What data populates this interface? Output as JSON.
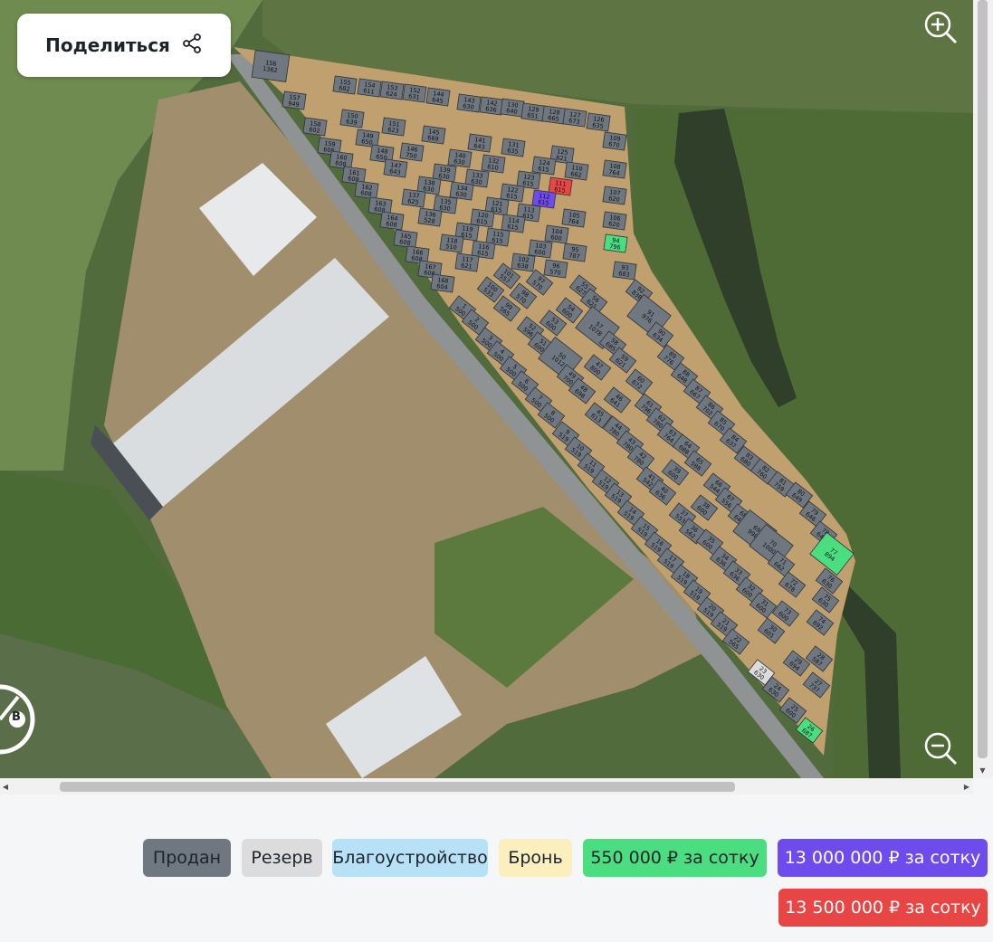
{
  "share": {
    "label": "Поделиться",
    "icon": "share-icon"
  },
  "compass": {
    "letter": "В"
  },
  "colors": {
    "sold": "#6f7780",
    "reserve": "#dcdcdc",
    "improvement": "#b6e1f7",
    "booked": "#fbefbd",
    "price_550k": "#4ade80",
    "price_13m": "#6d4bed",
    "price_13_5m": "#e84545",
    "road": "#bfa06e"
  },
  "legend": [
    {
      "label": "Продан",
      "color": "#6f7780"
    },
    {
      "label": "Резерв",
      "color": "#dcdcdc"
    },
    {
      "label": "Благоустройство",
      "color": "#b6e1f7"
    },
    {
      "label": "Бронь",
      "color": "#fbefbd"
    },
    {
      "label": "550 000 ₽ за сотку",
      "color": "#4ade80"
    },
    {
      "label": "13 000 000 ₽ за сотку",
      "color": "#6d4bed"
    },
    {
      "label": "13 500 000 ₽ за сотку",
      "color": "#e84545"
    }
  ],
  "plots": [
    {
      "n": "156",
      "a": "1362",
      "s": "sold"
    },
    {
      "n": "157",
      "a": "949",
      "s": "sold"
    },
    {
      "n": "158",
      "a": "602",
      "s": "sold"
    },
    {
      "n": "155",
      "a": "682",
      "s": "sold"
    },
    {
      "n": "154",
      "a": "611",
      "s": "sold"
    },
    {
      "n": "153",
      "a": "624",
      "s": "sold"
    },
    {
      "n": "152",
      "a": "631",
      "s": "sold"
    },
    {
      "n": "144",
      "a": "645",
      "s": "sold"
    },
    {
      "n": "143",
      "a": "630",
      "s": "sold"
    },
    {
      "n": "142",
      "a": "636",
      "s": "sold"
    },
    {
      "n": "130",
      "a": "640",
      "s": "sold"
    },
    {
      "n": "129",
      "a": "651",
      "s": "sold"
    },
    {
      "n": "128",
      "a": "665",
      "s": "sold"
    },
    {
      "n": "127",
      "a": "673",
      "s": "sold"
    },
    {
      "n": "126",
      "a": "635",
      "s": "sold"
    },
    {
      "n": "150",
      "a": "639",
      "s": "sold"
    },
    {
      "n": "151",
      "a": "623",
      "s": "sold"
    },
    {
      "n": "145",
      "a": "669",
      "s": "sold"
    },
    {
      "n": "159",
      "a": "606",
      "s": "sold"
    },
    {
      "n": "149",
      "a": "650",
      "s": "sold"
    },
    {
      "n": "148",
      "a": "650",
      "s": "sold"
    },
    {
      "n": "146",
      "a": "750",
      "s": "sold"
    },
    {
      "n": "141",
      "a": "643",
      "s": "sold"
    },
    {
      "n": "131",
      "a": "635",
      "s": "sold"
    },
    {
      "n": "160",
      "a": "608",
      "s": "sold"
    },
    {
      "n": "147",
      "a": "643",
      "s": "sold"
    },
    {
      "n": "140",
      "a": "630",
      "s": "sold"
    },
    {
      "n": "132",
      "a": "610",
      "s": "sold"
    },
    {
      "n": "125",
      "a": "621",
      "s": "sold"
    },
    {
      "n": "109",
      "a": "670",
      "s": "sold"
    },
    {
      "n": "161",
      "a": "608",
      "s": "sold"
    },
    {
      "n": "139",
      "a": "630",
      "s": "sold"
    },
    {
      "n": "133",
      "a": "630",
      "s": "sold"
    },
    {
      "n": "124",
      "a": "615",
      "s": "sold"
    },
    {
      "n": "110",
      "a": "662",
      "s": "sold"
    },
    {
      "n": "108",
      "a": "764",
      "s": "sold"
    },
    {
      "n": "162",
      "a": "608",
      "s": "sold"
    },
    {
      "n": "138",
      "a": "630",
      "s": "sold"
    },
    {
      "n": "134",
      "a": "630",
      "s": "sold"
    },
    {
      "n": "123",
      "a": "615",
      "s": "sold"
    },
    {
      "n": "111",
      "a": "615",
      "s": "price_13_5m"
    },
    {
      "n": "107",
      "a": "620",
      "s": "sold"
    },
    {
      "n": "137",
      "a": "625",
      "s": "sold"
    },
    {
      "n": "122",
      "a": "615",
      "s": "sold"
    },
    {
      "n": "112",
      "a": "615",
      "s": "price_13m"
    },
    {
      "n": "163",
      "a": "608",
      "s": "sold"
    },
    {
      "n": "135",
      "a": "630",
      "s": "sold"
    },
    {
      "n": "121",
      "a": "615",
      "s": "sold"
    },
    {
      "n": "113",
      "a": "615",
      "s": "sold"
    },
    {
      "n": "105",
      "a": "764",
      "s": "sold"
    },
    {
      "n": "106",
      "a": "620",
      "s": "sold"
    },
    {
      "n": "164",
      "a": "608",
      "s": "sold"
    },
    {
      "n": "136",
      "a": "528",
      "s": "sold"
    },
    {
      "n": "120",
      "a": "615",
      "s": "sold"
    },
    {
      "n": "114",
      "a": "615",
      "s": "sold"
    },
    {
      "n": "104",
      "a": "600",
      "s": "sold"
    },
    {
      "n": "94",
      "a": "796",
      "s": "price_550k"
    },
    {
      "n": "165",
      "a": "608",
      "s": "sold"
    },
    {
      "n": "119",
      "a": "615",
      "s": "sold"
    },
    {
      "n": "115",
      "a": "615",
      "s": "sold"
    },
    {
      "n": "103",
      "a": "600",
      "s": "sold"
    },
    {
      "n": "95",
      "a": "787",
      "s": "sold"
    },
    {
      "n": "166",
      "a": "608",
      "s": "sold"
    },
    {
      "n": "118",
      "a": "510",
      "s": "sold"
    },
    {
      "n": "116",
      "a": "615",
      "s": "sold"
    },
    {
      "n": "102",
      "a": "638",
      "s": "sold"
    },
    {
      "n": "96",
      "a": "570",
      "s": "sold"
    },
    {
      "n": "93",
      "a": "683",
      "s": "sold"
    },
    {
      "n": "167",
      "a": "608",
      "s": "sold"
    },
    {
      "n": "117",
      "a": "621",
      "s": "sold"
    },
    {
      "n": "101",
      "a": "557",
      "s": "sold"
    },
    {
      "n": "97",
      "a": "570",
      "s": "sold"
    },
    {
      "n": "55",
      "a": "627",
      "s": "sold"
    },
    {
      "n": "92",
      "a": "838",
      "s": "sold"
    },
    {
      "n": "168",
      "a": "604",
      "s": "sold"
    },
    {
      "n": "100",
      "a": "533",
      "s": "sold"
    },
    {
      "n": "98",
      "a": "570",
      "s": "sold"
    },
    {
      "n": "56",
      "a": "621",
      "s": "sold"
    },
    {
      "n": "91",
      "a": "976",
      "s": "sold"
    },
    {
      "n": "1",
      "a": "500",
      "s": "sold"
    },
    {
      "n": "99",
      "a": "565",
      "s": "sold"
    },
    {
      "n": "54",
      "a": "600",
      "s": "sold"
    },
    {
      "n": "2",
      "a": "500",
      "s": "sold"
    },
    {
      "n": "53",
      "a": "600",
      "s": "sold"
    },
    {
      "n": "57",
      "a": "1078",
      "s": "sold"
    },
    {
      "n": "52",
      "a": "596",
      "s": "sold"
    },
    {
      "n": "90",
      "a": "634",
      "s": "sold"
    },
    {
      "n": "3",
      "a": "500",
      "s": "sold"
    },
    {
      "n": "51",
      "a": "600",
      "s": "sold"
    },
    {
      "n": "58",
      "a": "685",
      "s": "sold"
    },
    {
      "n": "4",
      "a": "500",
      "s": "sold"
    },
    {
      "n": "50",
      "a": "1012",
      "s": "sold"
    },
    {
      "n": "59",
      "a": "621",
      "s": "sold"
    },
    {
      "n": "89",
      "a": "776",
      "s": "sold"
    },
    {
      "n": "5",
      "a": "500",
      "s": "sold"
    },
    {
      "n": "47",
      "a": "800",
      "s": "sold"
    },
    {
      "n": "49",
      "a": "700",
      "s": "sold"
    },
    {
      "n": "88",
      "a": "648",
      "s": "sold"
    },
    {
      "n": "6",
      "a": "500",
      "s": "sold"
    },
    {
      "n": "48",
      "a": "698",
      "s": "sold"
    },
    {
      "n": "60",
      "a": "672",
      "s": "sold"
    },
    {
      "n": "87",
      "a": "667",
      "s": "sold"
    },
    {
      "n": "7",
      "a": "500",
      "s": "sold"
    },
    {
      "n": "46",
      "a": "641",
      "s": "sold"
    },
    {
      "n": "61",
      "a": "796",
      "s": "sold"
    },
    {
      "n": "86",
      "a": "702",
      "s": "sold"
    },
    {
      "n": "8",
      "a": "500",
      "s": "sold"
    },
    {
      "n": "45",
      "a": "613",
      "s": "sold"
    },
    {
      "n": "62",
      "a": "780",
      "s": "sold"
    },
    {
      "n": "85",
      "a": "670",
      "s": "sold"
    },
    {
      "n": "9",
      "a": "519",
      "s": "sold"
    },
    {
      "n": "44",
      "a": "780",
      "s": "sold"
    },
    {
      "n": "63",
      "a": "764",
      "s": "sold"
    },
    {
      "n": "84",
      "a": "637",
      "s": "sold"
    },
    {
      "n": "10",
      "a": "519",
      "s": "sold"
    },
    {
      "n": "43",
      "a": "780",
      "s": "sold"
    },
    {
      "n": "64",
      "a": "688",
      "s": "sold"
    },
    {
      "n": "83",
      "a": "680",
      "s": "sold"
    },
    {
      "n": "11",
      "a": "519",
      "s": "sold"
    },
    {
      "n": "42",
      "a": "780",
      "s": "sold"
    },
    {
      "n": "65",
      "a": "588",
      "s": "sold"
    },
    {
      "n": "82",
      "a": "760",
      "s": "sold"
    },
    {
      "n": "12",
      "a": "519",
      "s": "sold"
    },
    {
      "n": "41",
      "a": "542",
      "s": "sold"
    },
    {
      "n": "39",
      "a": "600",
      "s": "sold"
    },
    {
      "n": "81",
      "a": "759",
      "s": "sold"
    },
    {
      "n": "13",
      "a": "519",
      "s": "sold"
    },
    {
      "n": "40",
      "a": "636",
      "s": "sold"
    },
    {
      "n": "66",
      "a": "544",
      "s": "sold"
    },
    {
      "n": "80",
      "a": "649",
      "s": "sold"
    },
    {
      "n": "14",
      "a": "519",
      "s": "sold"
    },
    {
      "n": "37",
      "a": "553",
      "s": "sold"
    },
    {
      "n": "38",
      "a": "600",
      "s": "sold"
    },
    {
      "n": "67",
      "a": "556",
      "s": "sold"
    },
    {
      "n": "79",
      "a": "646",
      "s": "sold"
    },
    {
      "n": "15",
      "a": "519",
      "s": "sold"
    },
    {
      "n": "36",
      "a": "562",
      "s": "sold"
    },
    {
      "n": "68",
      "a": "647",
      "s": "sold"
    },
    {
      "n": "78",
      "a": "648",
      "s": "sold"
    },
    {
      "n": "16",
      "a": "519",
      "s": "sold"
    },
    {
      "n": "35",
      "a": "600",
      "s": "sold"
    },
    {
      "n": "69",
      "a": "998",
      "s": "sold"
    },
    {
      "n": "70",
      "a": "1000",
      "s": "sold"
    },
    {
      "n": "77",
      "a": "894",
      "s": "price_550k"
    },
    {
      "n": "17",
      "a": "519",
      "s": "sold"
    },
    {
      "n": "34",
      "a": "636",
      "s": "sold"
    },
    {
      "n": "71",
      "a": "662",
      "s": "sold"
    },
    {
      "n": "76",
      "a": "630",
      "s": "sold"
    },
    {
      "n": "18",
      "a": "519",
      "s": "sold"
    },
    {
      "n": "33",
      "a": "636",
      "s": "sold"
    },
    {
      "n": "72",
      "a": "678",
      "s": "sold"
    },
    {
      "n": "19",
      "a": "519",
      "s": "sold"
    },
    {
      "n": "32",
      "a": "600",
      "s": "sold"
    },
    {
      "n": "75",
      "a": "630",
      "s": "sold"
    },
    {
      "n": "20",
      "a": "519",
      "s": "sold"
    },
    {
      "n": "31",
      "a": "600",
      "s": "sold"
    },
    {
      "n": "73",
      "a": "600",
      "s": "sold"
    },
    {
      "n": "74",
      "a": "692",
      "s": "sold"
    },
    {
      "n": "21",
      "a": "519",
      "s": "sold"
    },
    {
      "n": "30",
      "a": "601",
      "s": "sold"
    },
    {
      "n": "22",
      "a": "565",
      "s": "sold"
    },
    {
      "n": "29",
      "a": "694",
      "s": "sold"
    },
    {
      "n": "28",
      "a": "587",
      "s": "sold"
    },
    {
      "n": "23",
      "a": "630",
      "s": "reserve"
    },
    {
      "n": "27",
      "a": "737",
      "s": "sold"
    },
    {
      "n": "24",
      "a": "630",
      "s": "sold"
    },
    {
      "n": "25",
      "a": "600",
      "s": "sold"
    },
    {
      "n": "26",
      "a": "687",
      "s": "price_550k"
    }
  ]
}
